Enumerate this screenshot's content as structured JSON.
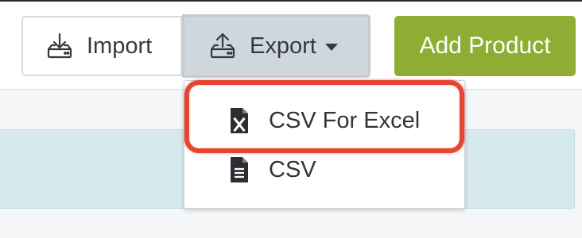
{
  "toolbar": {
    "import_label": "Import",
    "export_label": "Export",
    "add_product_label": "Add Product",
    "add_product_color": "#8ead32",
    "import_icon": "download-tray-icon",
    "export_icon": "upload-tray-icon"
  },
  "export_menu": {
    "items": [
      {
        "label": "CSV For Excel",
        "icon": "excel-file-icon"
      },
      {
        "label": "CSV",
        "icon": "document-file-icon"
      }
    ],
    "highlight_color": "#e6452f"
  }
}
